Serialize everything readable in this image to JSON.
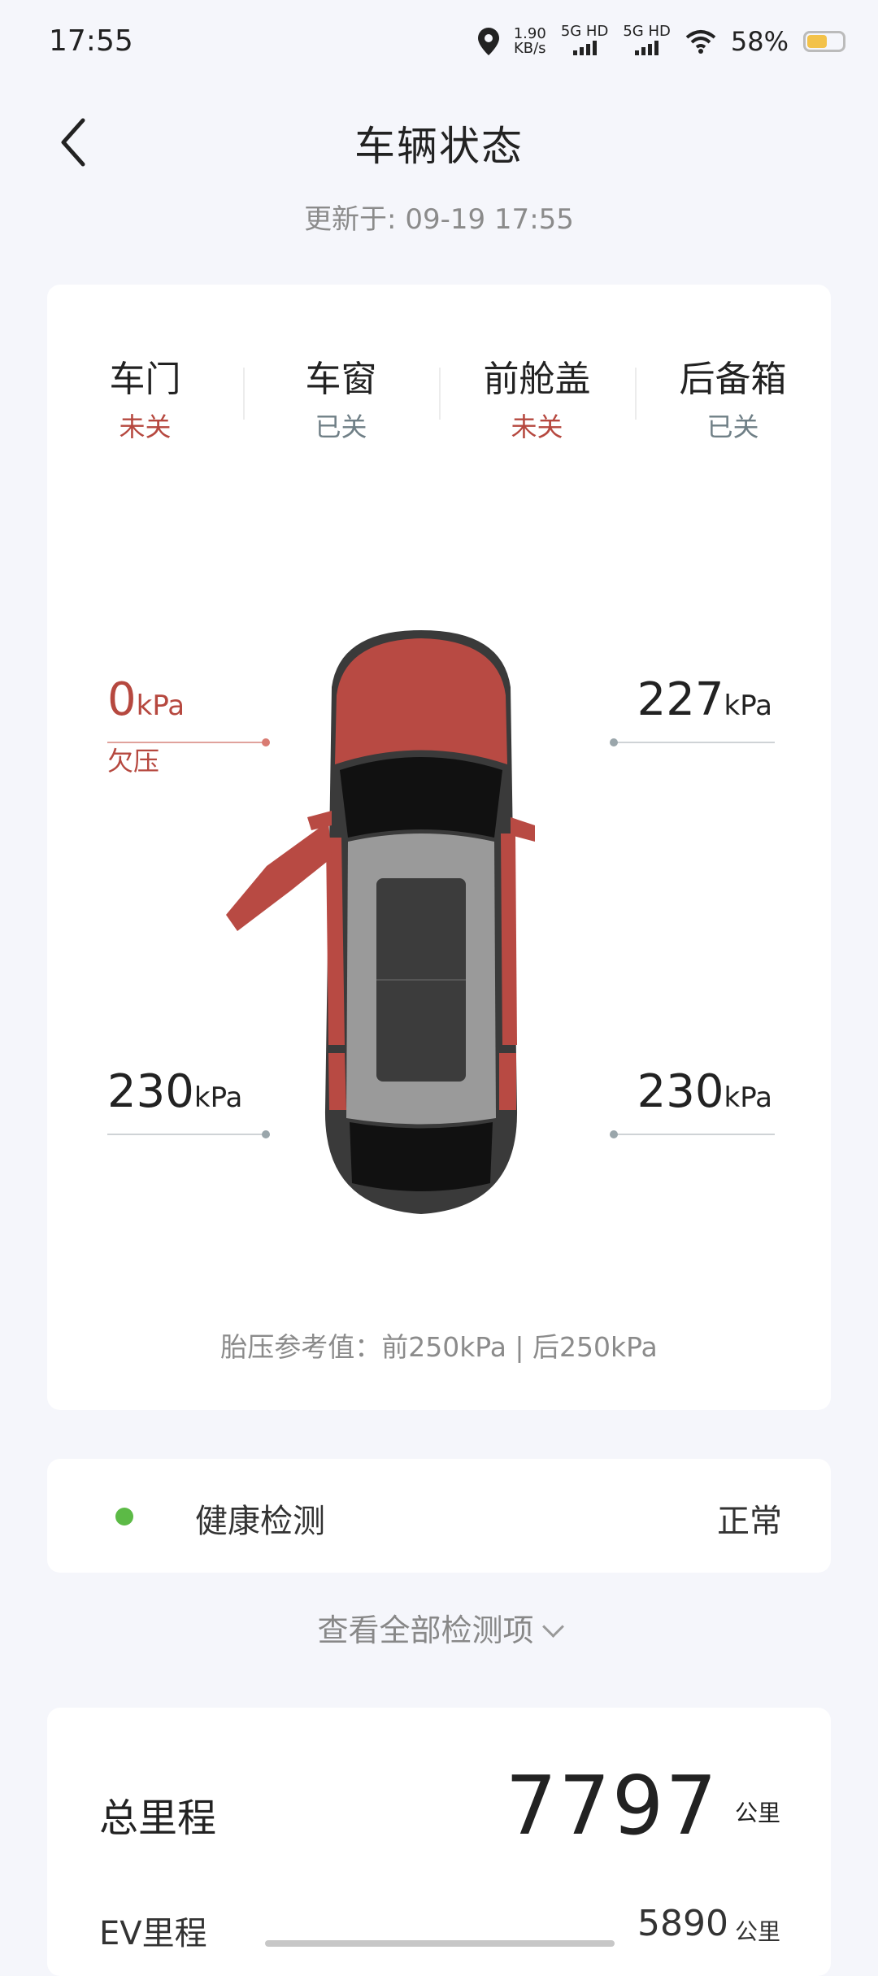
{
  "status_bar": {
    "time": "17:55",
    "net_speed_value": "1.90",
    "net_speed_unit": "KB/s",
    "sim1": "5G HD",
    "sim2": "5G HD",
    "battery_pct": "58%",
    "battery_level": 0.58,
    "icons": [
      "location-icon",
      "signal-icon",
      "wifi-icon",
      "battery-icon"
    ]
  },
  "header": {
    "title": "车辆状态",
    "updated": "更新于: 09-19 17:55"
  },
  "status": [
    {
      "name": "车门",
      "value": "未关",
      "color": "#b6483f"
    },
    {
      "name": "车窗",
      "value": "已关",
      "color": "#6f7f86"
    },
    {
      "name": "前舱盖",
      "value": "未关",
      "color": "#b6483f"
    },
    {
      "name": "后备箱",
      "value": "已关",
      "color": "#6f7f86"
    }
  ],
  "tires": {
    "front_left": {
      "value": "0",
      "unit": "kPa",
      "warning": "欠压"
    },
    "front_right": {
      "value": "227",
      "unit": "kPa"
    },
    "rear_left": {
      "value": "230",
      "unit": "kPa"
    },
    "rear_right": {
      "value": "230",
      "unit": "kPa"
    }
  },
  "reference": "胎压参考值：前250kPa | 后250kPa",
  "health": {
    "label": "健康检测",
    "value": "正常",
    "status_color": "#5cba46"
  },
  "view_all": "查看全部检测项",
  "mileage": {
    "total_label": "总里程",
    "total_value": "7797",
    "total_unit": "公里",
    "ev_label": "EV里程",
    "ev_value": "5890",
    "ev_unit": "公里"
  },
  "colors": {
    "warning": "#b6483f",
    "normal": "#6f7f86",
    "car_body": "#b84a43"
  }
}
